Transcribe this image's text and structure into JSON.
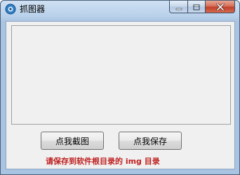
{
  "window": {
    "title": "抓图器",
    "icon": "app-icon"
  },
  "caption": {
    "minimize_icon": "minimize-icon",
    "maximize_icon": "maximize-icon",
    "close_icon": "close-icon"
  },
  "buttons": {
    "capture_label": "点我截图",
    "save_label": "点我保存"
  },
  "hint": {
    "text": "请保存到软件根目录的 img 目录",
    "color": "#c02020"
  }
}
